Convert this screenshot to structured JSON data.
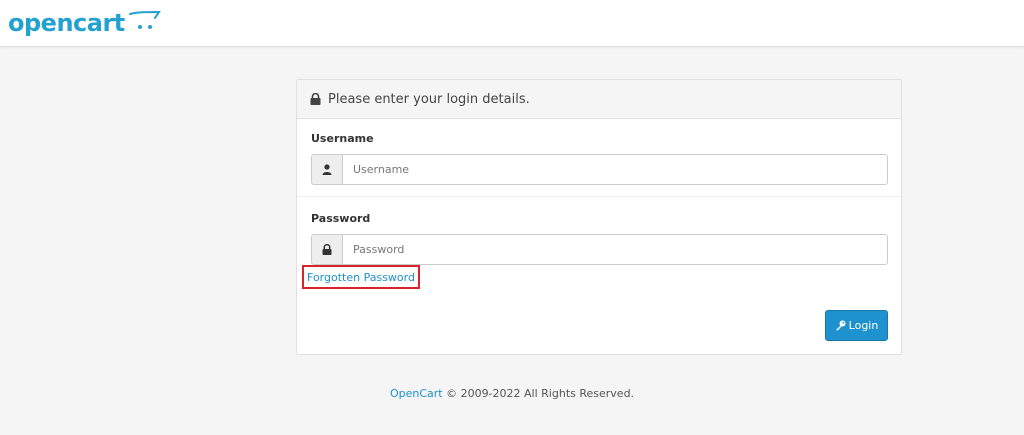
{
  "header": {
    "logo_text": "opencart",
    "brand_color": "#23a1d1"
  },
  "login_panel": {
    "heading_icon": "lock-icon",
    "heading": "Please enter your login details.",
    "username": {
      "label": "Username",
      "icon": "user-icon",
      "value": "",
      "placeholder": "Username"
    },
    "password": {
      "label": "Password",
      "icon": "lock-icon",
      "value": "",
      "placeholder": "Password"
    },
    "forgot_link": "Forgotten Password",
    "highlight_color": "#d9232d",
    "login_button": {
      "icon": "key-icon",
      "label": "Login",
      "color": "#1e91cf"
    }
  },
  "footer": {
    "link_text": "OpenCart",
    "text": "© 2009-2022 All Rights Reserved."
  }
}
